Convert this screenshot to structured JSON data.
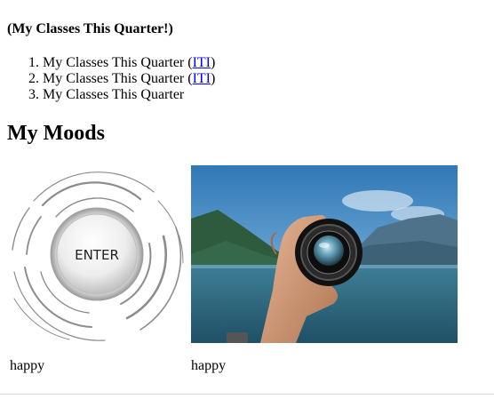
{
  "header": {
    "subtitle": "(My Classes This Quarter!)"
  },
  "classes": [
    {
      "label": "My Classes This Quarter",
      "link": "ITI"
    },
    {
      "label": "My Classes This Quarter",
      "link": "ITI"
    },
    {
      "label": "My Classes This Quarter"
    }
  ],
  "moods": {
    "title": "My Moods",
    "items": [
      {
        "caption": "happy",
        "image_text": "ENTER"
      },
      {
        "caption": "happy"
      }
    ]
  }
}
